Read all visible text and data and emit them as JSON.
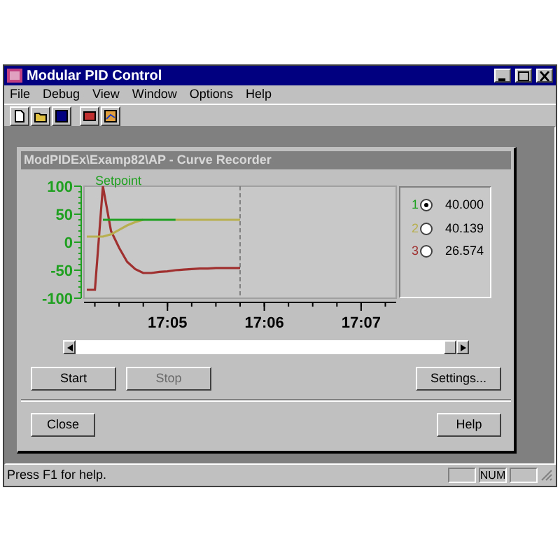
{
  "window": {
    "title": "Modular PID Control"
  },
  "menu": [
    "File",
    "Debug",
    "View",
    "Window",
    "Options",
    "Help"
  ],
  "child_window": {
    "title": "ModPIDEx\\Examp82\\AP - Curve Recorder",
    "chart_data": {
      "type": "line",
      "ylim": [
        -100,
        100
      ],
      "yticks": [
        -100,
        -50,
        0,
        50,
        100
      ],
      "categories": [
        null,
        null,
        null,
        null,
        null,
        null,
        null,
        null,
        null,
        null,
        "17:05",
        null,
        null,
        null,
        null,
        null,
        null,
        null,
        null,
        null,
        null,
        null,
        "17:06",
        null,
        null,
        null,
        null,
        null,
        null,
        null,
        null,
        null,
        null,
        null,
        "17:07",
        null,
        null,
        null,
        null
      ],
      "series": [
        {
          "name": "Setpoint",
          "color": "#20a020",
          "values": [
            null,
            null,
            40,
            40,
            40,
            40,
            40,
            40,
            40,
            40,
            40,
            40,
            null,
            null,
            null,
            null,
            null,
            null,
            null,
            null,
            null,
            null,
            null,
            null,
            null,
            null,
            null,
            null,
            null,
            null,
            null,
            null,
            null,
            null,
            null,
            null,
            null,
            null,
            null
          ]
        },
        {
          "color": "#b8b050",
          "values": [
            10,
            10,
            10,
            14,
            22,
            30,
            36,
            40,
            null,
            null,
            null,
            40,
            40,
            40,
            40,
            40,
            40,
            40,
            40,
            40,
            null,
            null,
            null,
            null,
            null,
            null,
            null,
            null,
            null,
            null,
            null,
            null,
            null,
            null,
            null,
            null,
            null,
            null,
            null
          ]
        },
        {
          "color": "#a03030",
          "values": [
            -85,
            -85,
            100,
            20,
            -10,
            -35,
            -48,
            -55,
            -55,
            -53,
            -52,
            -50,
            -49,
            -48,
            -47,
            -47,
            -46,
            -46,
            -46,
            -46,
            null,
            null,
            null,
            null,
            null,
            null,
            null,
            null,
            null,
            null,
            null,
            null,
            null,
            null,
            null,
            null,
            null,
            null,
            null
          ]
        }
      ]
    },
    "legend": [
      {
        "number": "1",
        "color": "#20a020",
        "selected": true,
        "value": "40.000"
      },
      {
        "number": "2",
        "color": "#b8b050",
        "selected": false,
        "value": "40.139"
      },
      {
        "number": "3",
        "color": "#a03030",
        "selected": false,
        "value": "26.574"
      }
    ],
    "buttons": [
      {
        "label": "Start",
        "disabled": false
      },
      {
        "label": "Stop",
        "disabled": true
      },
      {
        "label": "Settings...",
        "disabled": false
      }
    ],
    "footer_buttons": [
      "Close",
      "Help"
    ]
  },
  "status_bar": {
    "text": "Press F1 for help.",
    "panels": [
      "NUM"
    ]
  }
}
